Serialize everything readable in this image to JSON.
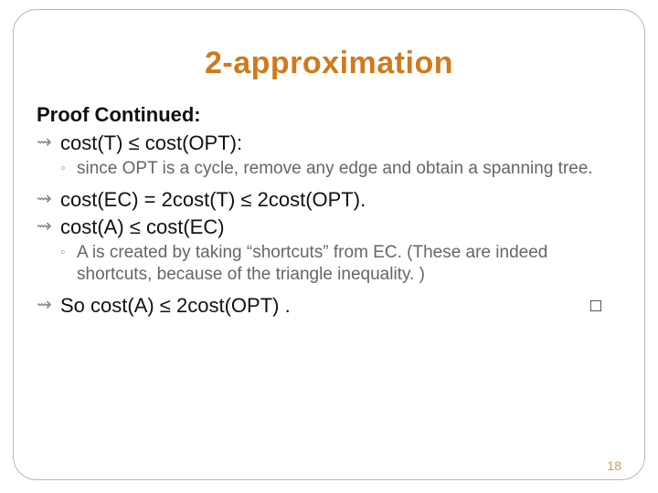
{
  "title": "2-approximation",
  "heading": "Proof Continued:",
  "bullets": {
    "b1": "cost(T) ≤ cost(OPT):",
    "s1": "since OPT is a cycle, remove any edge and obtain a spanning tree.",
    "b2": "cost(EC) = 2cost(T) ≤ 2cost(OPT).",
    "b3": "cost(A) ≤ cost(EC)",
    "s2": "A is created by taking “shortcuts” from EC. (These are indeed shortcuts,  because of the triangle inequality. )",
    "b4": "So cost(A) ≤ 2cost(OPT) ."
  },
  "glyphs": {
    "main": "⇝",
    "sub": "◦",
    "qed": "□"
  },
  "page_number": "18"
}
